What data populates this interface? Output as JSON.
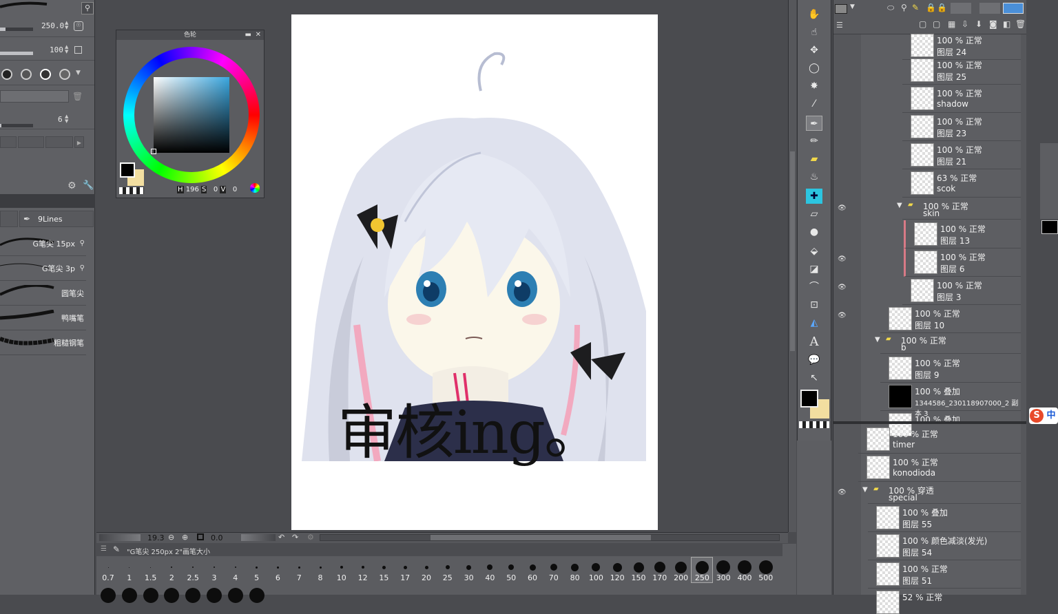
{
  "tool_property": {
    "size_value": "250.0",
    "opacity_value": "100",
    "density_value": "6",
    "brush_set_name": "9Lines",
    "brushes": [
      "G笔尖 15px",
      "G笔尖 3p",
      "圆笔尖",
      "鸭嘴笔",
      "粗糙钢笔"
    ]
  },
  "color_wheel": {
    "title": "色轮",
    "h_label": "H",
    "h_value": "196",
    "s_label": "S",
    "s_value": "0",
    "v_label": "V",
    "v_value": "0",
    "main_color": "#000000",
    "sub_color": "#f2dea0"
  },
  "canvas": {
    "overlay_text": "审核ing。",
    "paper_color": "#ffffff"
  },
  "navigator": {
    "zoom": "19.3",
    "angle": "0.0"
  },
  "brush_size_palette": {
    "title": "\"G笔尖 250px 2\"画笔大小",
    "sizes": [
      "0.7",
      "1",
      "1.5",
      "2",
      "2.5",
      "3",
      "4",
      "5",
      "6",
      "7",
      "8",
      "10",
      "12",
      "15",
      "17",
      "20",
      "25",
      "30",
      "40",
      "50",
      "60",
      "70",
      "80",
      "100",
      "120",
      "150",
      "170",
      "200",
      "250",
      "300",
      "400",
      "500"
    ],
    "selected": "250"
  },
  "layers": [
    {
      "mode": "100 % 正常",
      "name": "图层 24"
    },
    {
      "mode": "100 % 正常",
      "name": "图层 25"
    },
    {
      "mode": "100 % 正常",
      "name": "shadow"
    },
    {
      "mode": "100 % 正常",
      "name": "图层 23"
    },
    {
      "mode": "100 % 正常",
      "name": "图层 21"
    },
    {
      "mode": "63 % 正常",
      "name": "scok"
    },
    {
      "mode": "100 % 正常",
      "name": "skin"
    },
    {
      "mode": "100 % 正常",
      "name": "图层 13"
    },
    {
      "mode": "100 % 正常",
      "name": "图层 6"
    },
    {
      "mode": "100 % 正常",
      "name": "图层 3"
    },
    {
      "mode": "100 % 正常",
      "name": "图层 10"
    },
    {
      "mode": "100 % 正常",
      "name": "b"
    },
    {
      "mode": "100 % 正常",
      "name": "图层 9"
    },
    {
      "mode": "100 % 叠加",
      "name": "1344586_230118907000_2 副本 3"
    },
    {
      "mode": "100 % 叠加",
      "name": ""
    },
    {
      "mode": "100 % 正常",
      "name": "timer"
    },
    {
      "mode": "100 % 正常",
      "name": "konodioda"
    },
    {
      "mode": "100 % 穿透",
      "name": "special"
    },
    {
      "mode": "100 % 叠加",
      "name": "图层 55"
    },
    {
      "mode": "100 % 颜色减淡(发光)",
      "name": "图层 54"
    },
    {
      "mode": "100 % 正常",
      "name": "图层 51"
    },
    {
      "mode": "52 % 正常",
      "name": ""
    }
  ],
  "ime_badge": "中"
}
